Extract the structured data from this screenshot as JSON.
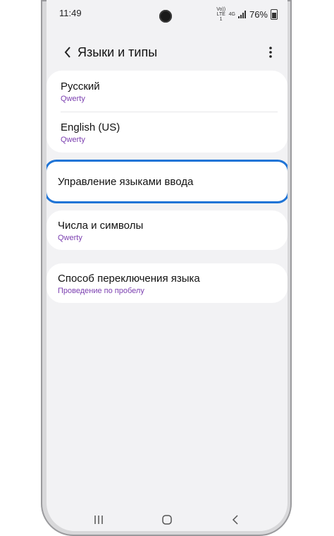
{
  "status_bar": {
    "time": "11:49",
    "volte_label": "Vo)) LTE1",
    "network_label": "4G",
    "battery": "76%"
  },
  "header": {
    "title": "Языки и типы",
    "back_icon": "chevron-left-icon",
    "more_icon": "more-vertical-icon"
  },
  "languages": [
    {
      "name": "Русский",
      "layout": "Qwerty"
    },
    {
      "name": "English (US)",
      "layout": "Qwerty"
    }
  ],
  "manage_input_languages": {
    "label": "Управление языками ввода"
  },
  "numbers_symbols": {
    "label": "Числа и символы",
    "value": "Qwerty"
  },
  "language_switch": {
    "label": "Способ переключения языка",
    "value": "Проведение по пробелу"
  },
  "navbar": {
    "recents_icon": "recents-icon",
    "home_icon": "home-icon",
    "back_icon": "back-icon"
  },
  "colors": {
    "accent_purple": "#7b3fb0",
    "highlight_blue": "#1f74d6",
    "background": "#f2f2f4"
  }
}
